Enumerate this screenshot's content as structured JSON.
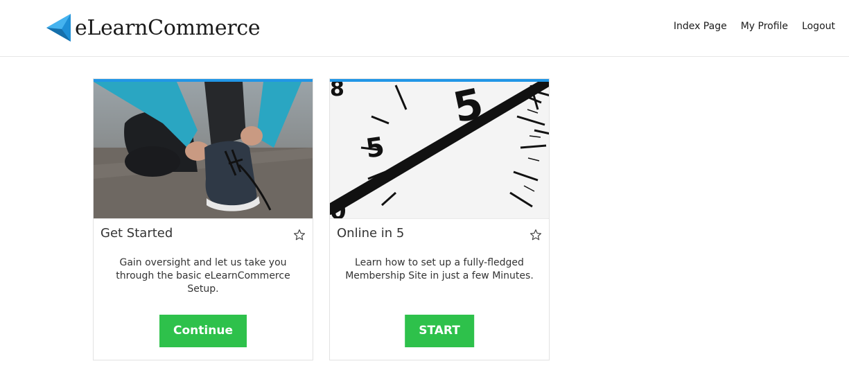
{
  "header": {
    "logo_text": "eLearnCommerce",
    "nav": [
      {
        "label": "Index Page"
      },
      {
        "label": "My Profile"
      },
      {
        "label": "Logout"
      }
    ]
  },
  "colors": {
    "accent_bar": "#2196e6",
    "button": "#2ec14b",
    "logo_blue": "#1e8fd6"
  },
  "cards": [
    {
      "title": "Get Started",
      "description": "Gain oversight and let us take you through the basic eLearnCommerce Setup.",
      "button_label": "Continue",
      "image": "runner-tying-shoe-photo",
      "favorite_icon": "star-outline-icon"
    },
    {
      "title": "Online in 5",
      "description": "Learn how to set up a fully-fledged Membership Site in just a few Minutes.",
      "button_label": "START",
      "image": "stopwatch-closeup-photo",
      "favorite_icon": "star-outline-icon"
    }
  ]
}
